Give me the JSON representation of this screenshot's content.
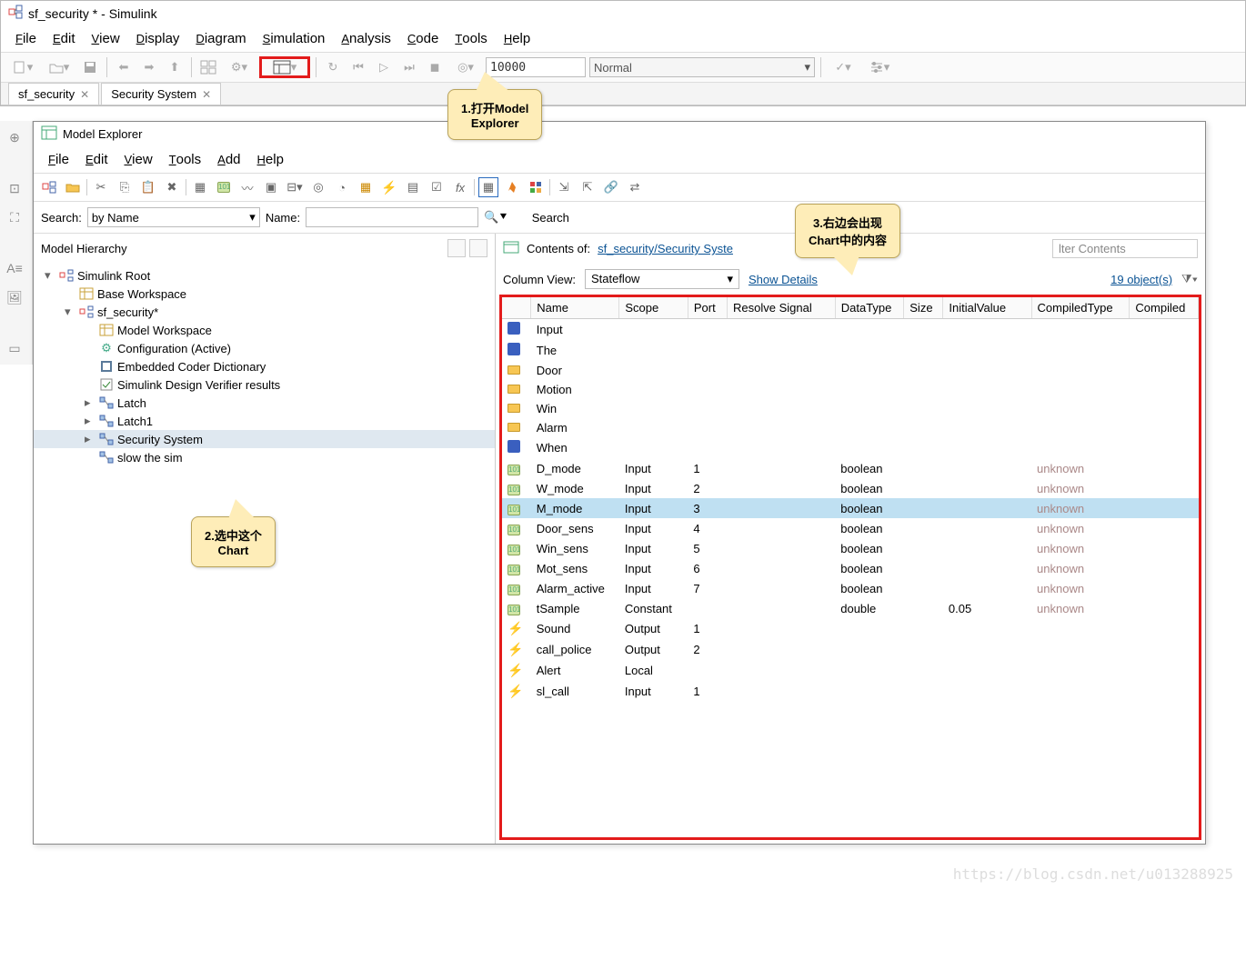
{
  "main": {
    "title": "sf_security * - Simulink",
    "menus": [
      "File",
      "Edit",
      "View",
      "Display",
      "Diagram",
      "Simulation",
      "Analysis",
      "Code",
      "Tools",
      "Help"
    ],
    "stop_time": "10000",
    "sim_mode": "Normal",
    "tabs": [
      {
        "label": "sf_security"
      },
      {
        "label": "Security System"
      }
    ]
  },
  "callouts": {
    "c1_line1": "1.打开Model",
    "c1_line2": "Explorer",
    "c2_line1": "2.选中这个",
    "c2_line2": "Chart",
    "c3_line1": "3.右边会出现",
    "c3_line2": "Chart中的内容"
  },
  "me": {
    "title": "Model Explorer",
    "menus": [
      "File",
      "Edit",
      "View",
      "Tools",
      "Add",
      "Help"
    ],
    "search_label": "Search:",
    "search_mode": "by Name",
    "name_label": "Name:",
    "name_value": "",
    "search_btn": "Search",
    "hierarchy_title": "Model Hierarchy",
    "tree": [
      {
        "indent": 0,
        "caret": "▾",
        "icon": "sl",
        "label": "Simulink Root"
      },
      {
        "indent": 1,
        "caret": "",
        "icon": "ws",
        "label": "Base Workspace"
      },
      {
        "indent": 1,
        "caret": "▾",
        "icon": "mdl",
        "label": "sf_security*"
      },
      {
        "indent": 2,
        "caret": "",
        "icon": "ws",
        "label": "Model Workspace"
      },
      {
        "indent": 2,
        "caret": "",
        "icon": "cfg",
        "label": "Configuration (Active)"
      },
      {
        "indent": 2,
        "caret": "",
        "icon": "dict",
        "label": "Embedded Coder Dictionary"
      },
      {
        "indent": 2,
        "caret": "",
        "icon": "sldv",
        "label": "Simulink Design Verifier results"
      },
      {
        "indent": 2,
        "caret": "▸",
        "icon": "chart",
        "label": "Latch"
      },
      {
        "indent": 2,
        "caret": "▸",
        "icon": "chart",
        "label": "Latch1"
      },
      {
        "indent": 2,
        "caret": "▸",
        "icon": "chart",
        "label": "Security System",
        "selected": true
      },
      {
        "indent": 2,
        "caret": "",
        "icon": "chart",
        "label": "slow the sim"
      }
    ],
    "contents_label": "Contents of:",
    "contents_path": "sf_security/Security Syste",
    "filter_placeholder": "lter Contents",
    "colview_label": "Column View:",
    "colview_value": "Stateflow",
    "show_details": "Show Details",
    "objects_count": "19 object(s)",
    "columns": [
      "",
      "Name",
      "Scope",
      "Port",
      "Resolve Signal",
      "DataType",
      "Size",
      "InitialValue",
      "CompiledType",
      "Compiled"
    ],
    "rows": [
      {
        "icon": "state",
        "name": "Input"
      },
      {
        "icon": "state",
        "name": "The"
      },
      {
        "icon": "folder",
        "name": "Door"
      },
      {
        "icon": "folder",
        "name": "Motion"
      },
      {
        "icon": "folder",
        "name": "Win"
      },
      {
        "icon": "folder",
        "name": "Alarm"
      },
      {
        "icon": "state",
        "name": "When"
      },
      {
        "icon": "data",
        "name": "D_mode",
        "scope": "Input",
        "port": "1",
        "dtype": "boolean",
        "ctype": "unknown"
      },
      {
        "icon": "data",
        "name": "W_mode",
        "scope": "Input",
        "port": "2",
        "dtype": "boolean",
        "ctype": "unknown"
      },
      {
        "icon": "data",
        "name": "M_mode",
        "scope": "Input",
        "port": "3",
        "dtype": "boolean",
        "ctype": "unknown",
        "selected": true
      },
      {
        "icon": "data",
        "name": "Door_sens",
        "scope": "Input",
        "port": "4",
        "dtype": "boolean",
        "ctype": "unknown"
      },
      {
        "icon": "data",
        "name": "Win_sens",
        "scope": "Input",
        "port": "5",
        "dtype": "boolean",
        "ctype": "unknown"
      },
      {
        "icon": "data",
        "name": "Mot_sens",
        "scope": "Input",
        "port": "6",
        "dtype": "boolean",
        "ctype": "unknown"
      },
      {
        "icon": "data",
        "name": "Alarm_active",
        "scope": "Input",
        "port": "7",
        "dtype": "boolean",
        "ctype": "unknown"
      },
      {
        "icon": "data",
        "name": "tSample",
        "scope": "Constant",
        "dtype": "double",
        "init": "0.05",
        "ctype": "unknown"
      },
      {
        "icon": "bolt",
        "name": "Sound",
        "scope": "Output",
        "port": "1"
      },
      {
        "icon": "bolt",
        "name": "call_police",
        "scope": "Output",
        "port": "2"
      },
      {
        "icon": "bolt",
        "name": "Alert",
        "scope": "Local"
      },
      {
        "icon": "bolt",
        "name": "sl_call",
        "scope": "Input",
        "port": "1"
      }
    ]
  },
  "watermark": "https://blog.csdn.net/u013288925"
}
